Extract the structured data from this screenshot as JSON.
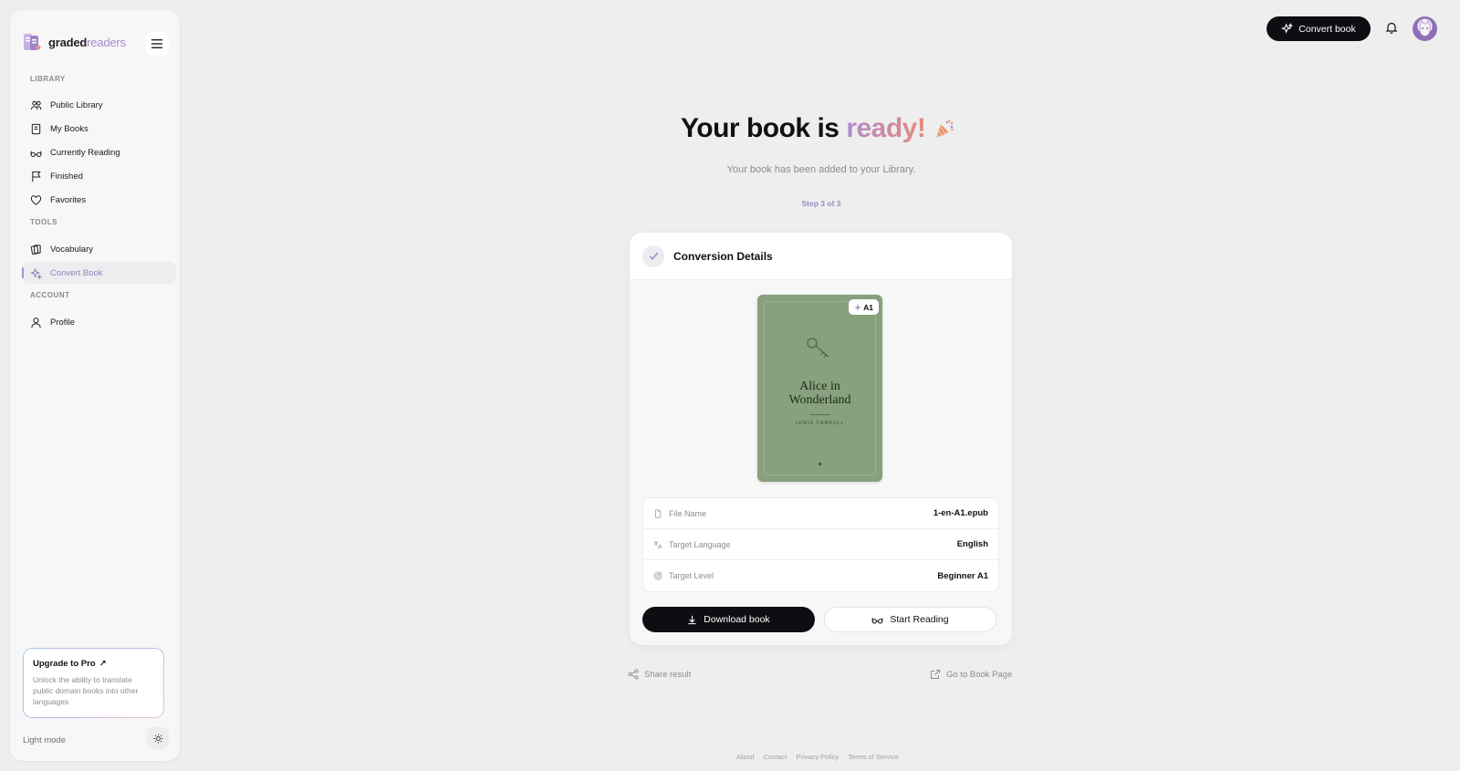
{
  "app": {
    "logo_part1": "graded",
    "logo_part2": "readers"
  },
  "sidebar": {
    "sections": {
      "library": "LIBRARY",
      "tools": "TOOLS",
      "account": "ACCOUNT"
    },
    "items": {
      "public_library": "Public Library",
      "my_books": "My Books",
      "currently_reading": "Currently Reading",
      "finished": "Finished",
      "favorites": "Favorites",
      "vocabulary": "Vocabulary",
      "convert_book": "Convert Book",
      "profile": "Profile"
    },
    "active_item": "Convert Book",
    "upgrade": {
      "title": "Upgrade to Pro",
      "arrow": "↗",
      "description": "Unlock the ability to translate public domain books into other languages"
    },
    "light_mode_label": "Light mode"
  },
  "topbar": {
    "convert_label": "Convert book"
  },
  "main": {
    "title_part1": "Your book is",
    "title_part2": "ready!",
    "subtitle": "Your book has been added to your Library.",
    "step": "Step 3 of 3"
  },
  "card": {
    "title": "Conversion Details",
    "cover": {
      "title_line1": "Alice in",
      "title_line2": "Wonderland",
      "author": "LEWIS CARROLL",
      "level_badge": "A1"
    },
    "details": {
      "file_name_label": "File Name",
      "file_name_value": "1-en-A1.epub",
      "language_label": "Target Language",
      "language_value": "English",
      "level_label": "Target Level",
      "level_value": "Beginner A1"
    },
    "download_label": "Download book",
    "start_reading_label": "Start Reading"
  },
  "links": {
    "share": "Share result",
    "goto": "Go to Book Page"
  },
  "footer": [
    "About",
    "Contact",
    "Privacy Policy",
    "Terms of Service"
  ],
  "colors": {
    "accent": "#0e0e12",
    "ready_gradient_start": "#b08bd0",
    "ready_gradient_end": "#e58a78",
    "cover_green": "#87a07d",
    "active_nav_text": "#8a87b8"
  }
}
